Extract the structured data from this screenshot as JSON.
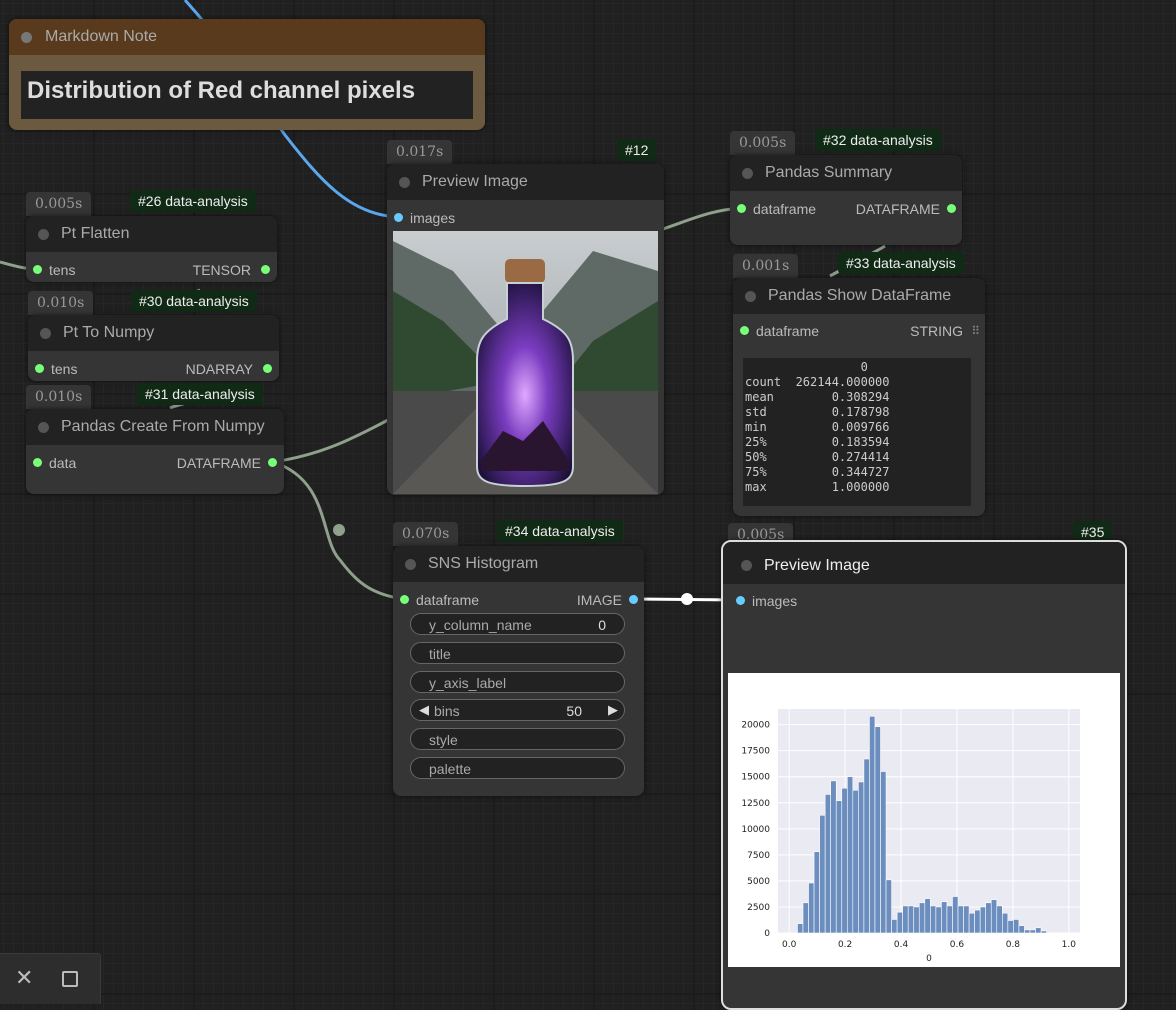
{
  "markdown_note": {
    "title": "Markdown Note",
    "content": "Distribution of Red channel pixels"
  },
  "nodes": {
    "pt_flatten": {
      "time": "0.005s",
      "tag": "#26 data-analysis",
      "title": "Pt Flatten",
      "input": "tens",
      "output": "TENSOR"
    },
    "pt_to_numpy": {
      "time": "0.010s",
      "tag": "#30 data-analysis",
      "title": "Pt To Numpy",
      "input": "tens",
      "output": "NDARRAY"
    },
    "pandas_create": {
      "time": "0.010s",
      "tag": "#31 data-analysis",
      "title": "Pandas Create From Numpy",
      "input": "data",
      "output": "DATAFRAME"
    },
    "preview_image_12": {
      "time": "0.017s",
      "tag": "#12",
      "title": "Preview Image",
      "input": "images"
    },
    "pandas_summary": {
      "time": "0.005s",
      "tag": "#32 data-analysis",
      "title": "Pandas Summary",
      "input": "dataframe",
      "output": "DATAFRAME"
    },
    "pandas_show": {
      "time": "0.001s",
      "tag": "#33 data-analysis",
      "title": "Pandas Show DataFrame",
      "input": "dataframe",
      "output": "STRING",
      "table_lines": [
        "                0",
        "count  262144.000000",
        "mean        0.308294",
        "std         0.178798",
        "min         0.009766",
        "25%         0.183594",
        "50%         0.274414",
        "75%         0.344727",
        "max         1.000000"
      ]
    },
    "sns_histogram": {
      "time": "0.070s",
      "tag": "#34 data-analysis",
      "title": "SNS Histogram",
      "input": "dataframe",
      "output": "IMAGE",
      "widgets": {
        "y_column_name": {
          "label": "y_column_name",
          "value": "0"
        },
        "title": {
          "label": "title"
        },
        "y_axis_label": {
          "label": "y_axis_label"
        },
        "bins": {
          "label": "bins",
          "value": "50"
        },
        "style": {
          "label": "style"
        },
        "palette": {
          "label": "palette"
        }
      }
    },
    "preview_image_35": {
      "time": "0.005s",
      "tag": "#35",
      "title": "Preview Image",
      "input": "images"
    }
  },
  "chart_data": {
    "type": "bar",
    "title": "",
    "xlabel": "0",
    "ylabel": "",
    "xlim": [
      -0.04,
      1.04
    ],
    "ylim": [
      0,
      21500
    ],
    "xticks": [
      "0.0",
      "0.2",
      "0.4",
      "0.6",
      "0.8",
      "1.0"
    ],
    "yticks": [
      "0",
      "2500",
      "5000",
      "7500",
      "10000",
      "12500",
      "15000",
      "17500",
      "20000"
    ],
    "bin_width": 0.0198,
    "bin_starts": [
      0.0098,
      0.0296,
      0.0494,
      0.0692,
      0.089,
      0.1088,
      0.1286,
      0.1484,
      0.1682,
      0.188,
      0.2078,
      0.2276,
      0.2474,
      0.2672,
      0.287,
      0.3068,
      0.3266,
      0.3464,
      0.3662,
      0.386,
      0.4058,
      0.4256,
      0.4454,
      0.4652,
      0.485,
      0.5048,
      0.5246,
      0.5444,
      0.5642,
      0.584,
      0.6038,
      0.6236,
      0.6434,
      0.6632,
      0.683,
      0.7028,
      0.7226,
      0.7424,
      0.7622,
      0.782,
      0.8018,
      0.8216,
      0.8414,
      0.8612,
      0.881,
      0.9008,
      0.9206,
      0.9404,
      0.9602,
      0.98
    ],
    "values": [
      0,
      900,
      2900,
      4800,
      7800,
      11300,
      13300,
      14600,
      12700,
      13900,
      15000,
      13700,
      14500,
      16700,
      20800,
      19800,
      15500,
      5100,
      1300,
      2000,
      2600,
      2600,
      2500,
      2900,
      3300,
      2600,
      2500,
      3000,
      2600,
      3500,
      2600,
      2600,
      1900,
      2200,
      2500,
      2900,
      3200,
      2600,
      1900,
      1200,
      1300,
      700,
      300,
      300,
      500,
      200,
      0,
      0,
      0,
      0
    ],
    "grid": true,
    "style": "darkgrid",
    "bar_color": "#6c8ebf"
  },
  "colors": {
    "link_tensor": "#8fa08c",
    "link_image": "#5aa7ee",
    "pin_green": "#77ff77",
    "pin_blue": "#66ccff"
  },
  "toolbar": {
    "close_icon": "close-icon",
    "square_icon": "square-icon"
  }
}
